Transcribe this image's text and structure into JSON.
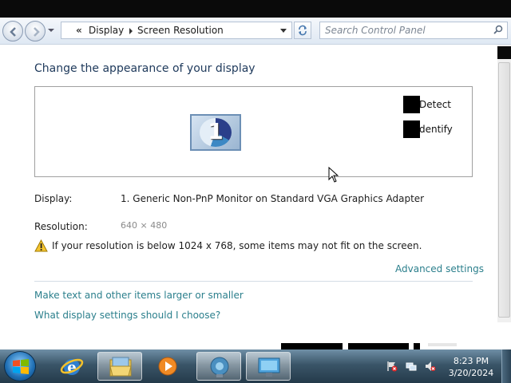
{
  "address_bar": {
    "overflow_glyph": "«",
    "crumbs": [
      "Display",
      "Screen Resolution"
    ]
  },
  "search": {
    "placeholder": "Search Control Panel"
  },
  "main": {
    "heading": "Change the appearance of your display",
    "preview": {
      "monitor_number": "1",
      "detect_label": "Detect",
      "identify_label": "dentify"
    },
    "display_label": "Display:",
    "display_value": "1. Generic Non-PnP Monitor on Standard VGA Graphics Adapter",
    "resolution_label": "Resolution:",
    "resolution_value": "640 × 480",
    "warning_text": "If your resolution is below 1024 x 768, some items may not fit on the screen.",
    "advanced_link": "Advanced settings",
    "links": [
      "Make text and other items larger or smaller",
      "What display settings should I choose?"
    ]
  },
  "taskbar": {
    "clock_time": "8:23 PM",
    "clock_date": "3/20/2024",
    "apps": [
      "internet-explorer",
      "windows-explorer",
      "media-player",
      "control-panel-globe",
      "display-settings"
    ]
  },
  "colors": {
    "heading": "#1e395b",
    "link": "#2b7f8c",
    "taskbar": "#3a5568"
  }
}
